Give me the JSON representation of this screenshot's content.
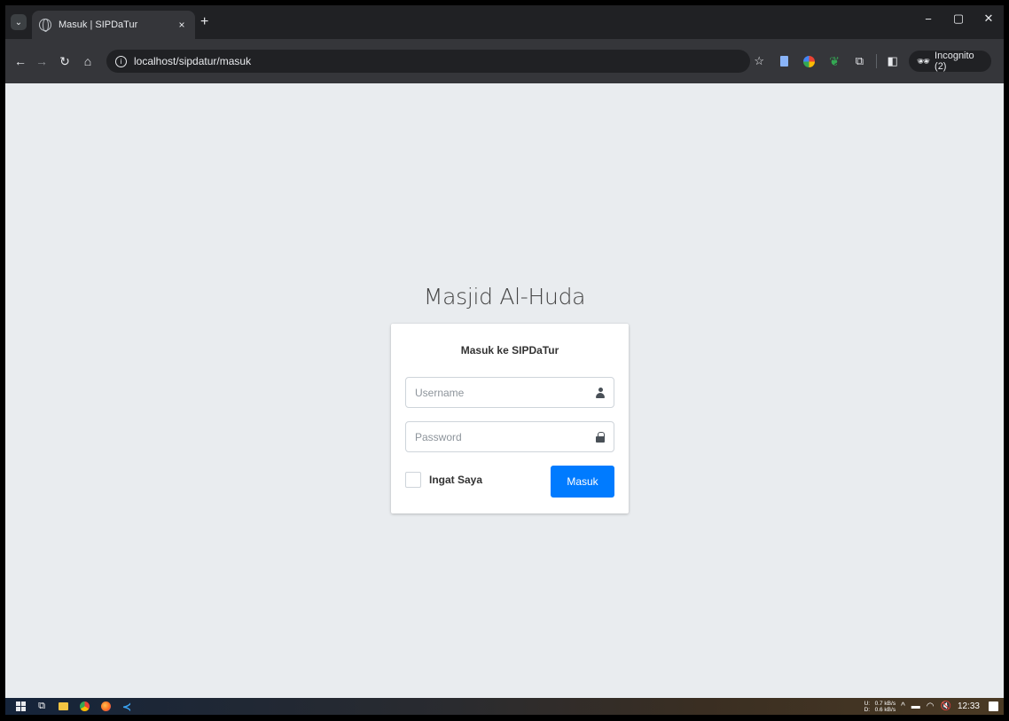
{
  "browser": {
    "tab": {
      "title": "Masuk | SIPDaTur",
      "close": "×"
    },
    "new_tab": "+",
    "window_controls": {
      "minimize": "−",
      "maximize": "▢",
      "close": "✕"
    },
    "nav": {
      "back": "←",
      "forward": "→",
      "reload": "↻",
      "home": "⌂"
    },
    "url": "localhost/sipdatur/masuk",
    "icons": {
      "bookmark_star": "☆",
      "extensions": "⧉",
      "side_panel": "◧",
      "menu": "⋮"
    },
    "incognito_label": "Incognito (2)"
  },
  "page": {
    "brand": "Masjid Al-Huda",
    "card_title": "Masuk ke SIPDaTur",
    "username": {
      "placeholder": "Username",
      "value": ""
    },
    "password": {
      "placeholder": "Password",
      "value": ""
    },
    "remember_label": "Ingat Saya",
    "remember_checked": false,
    "submit_label": "Masuk",
    "colors": {
      "background": "#e9ecef",
      "primary": "#007bff"
    }
  },
  "taskbar": {
    "net": {
      "up_label": "U:",
      "up_value": "0.7 kB/s",
      "down_label": "D:",
      "down_value": "0.6 kB/s"
    },
    "tray_chevron": "^",
    "time": "12:33"
  }
}
